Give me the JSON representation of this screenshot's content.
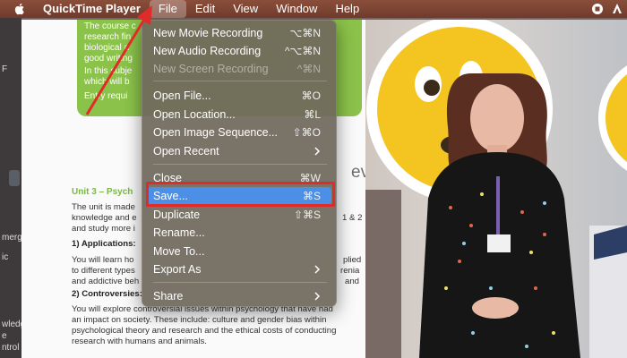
{
  "menubar": {
    "app_name": "QuickTime Player",
    "items": [
      "File",
      "Edit",
      "View",
      "Window",
      "Help"
    ],
    "active_item": "File"
  },
  "file_menu": {
    "items": [
      {
        "label": "New Movie Recording",
        "shortcut": "⌥⌘N",
        "enabled": true
      },
      {
        "label": "New Audio Recording",
        "shortcut": "^⌥⌘N",
        "enabled": true
      },
      {
        "label": "New Screen Recording",
        "shortcut": "^⌘N",
        "enabled": false
      },
      {
        "label": "Open File...",
        "shortcut": "⌘O",
        "enabled": true
      },
      {
        "label": "Open Location...",
        "shortcut": "⌘L",
        "enabled": true
      },
      {
        "label": "Open Image Sequence...",
        "shortcut": "⇧⌘O",
        "enabled": true
      },
      {
        "label": "Open Recent",
        "submenu": true,
        "enabled": true
      },
      {
        "label": "Close",
        "shortcut": "⌘W",
        "enabled": true
      },
      {
        "label": "Save...",
        "shortcut": "⌘S",
        "enabled": true,
        "highlighted": true
      },
      {
        "label": "Duplicate",
        "shortcut": "⇧⌘S",
        "enabled": true
      },
      {
        "label": "Rename...",
        "enabled": true
      },
      {
        "label": "Move To...",
        "enabled": true
      },
      {
        "label": "Export As",
        "submenu": true,
        "enabled": true
      },
      {
        "label": "Share",
        "submenu": true,
        "enabled": true
      }
    ]
  },
  "document": {
    "green_box_lines": [
      "The course c",
      "research fin",
      "biological a",
      "good writing",
      "In this subje",
      "which will b",
      "Entry requi"
    ],
    "unit_heading": "Unit 3 – Psych",
    "lines_left": [
      "The unit is made",
      "knowledge and e",
      "and study more i"
    ],
    "applications": "1) Applications:",
    "app_lines": [
      "You will learn ho",
      "to different types",
      "and addictive beh"
    ],
    "controversies": "2) Controversies:",
    "para_lines": [
      "You will explore controversial issues within psychology that have had",
      "an impact on society. These include: culture and gender bias within",
      "psychological theory and research and the ethical costs of conducting",
      "research with humans and animals."
    ],
    "right_fragments": [
      "1 & 2",
      "plied",
      "renia",
      "and"
    ],
    "heading_fragment": "evel"
  },
  "left_strip_labels": [
    "F",
    "merging",
    "ic",
    "wledge",
    "e",
    "ntrol"
  ],
  "colors": {
    "highlight": "#4b8fe6",
    "callout": "#e12b2b",
    "menu_bg": "#70685c",
    "menubar": "#7b4433",
    "doc_green": "#8bc34a"
  }
}
